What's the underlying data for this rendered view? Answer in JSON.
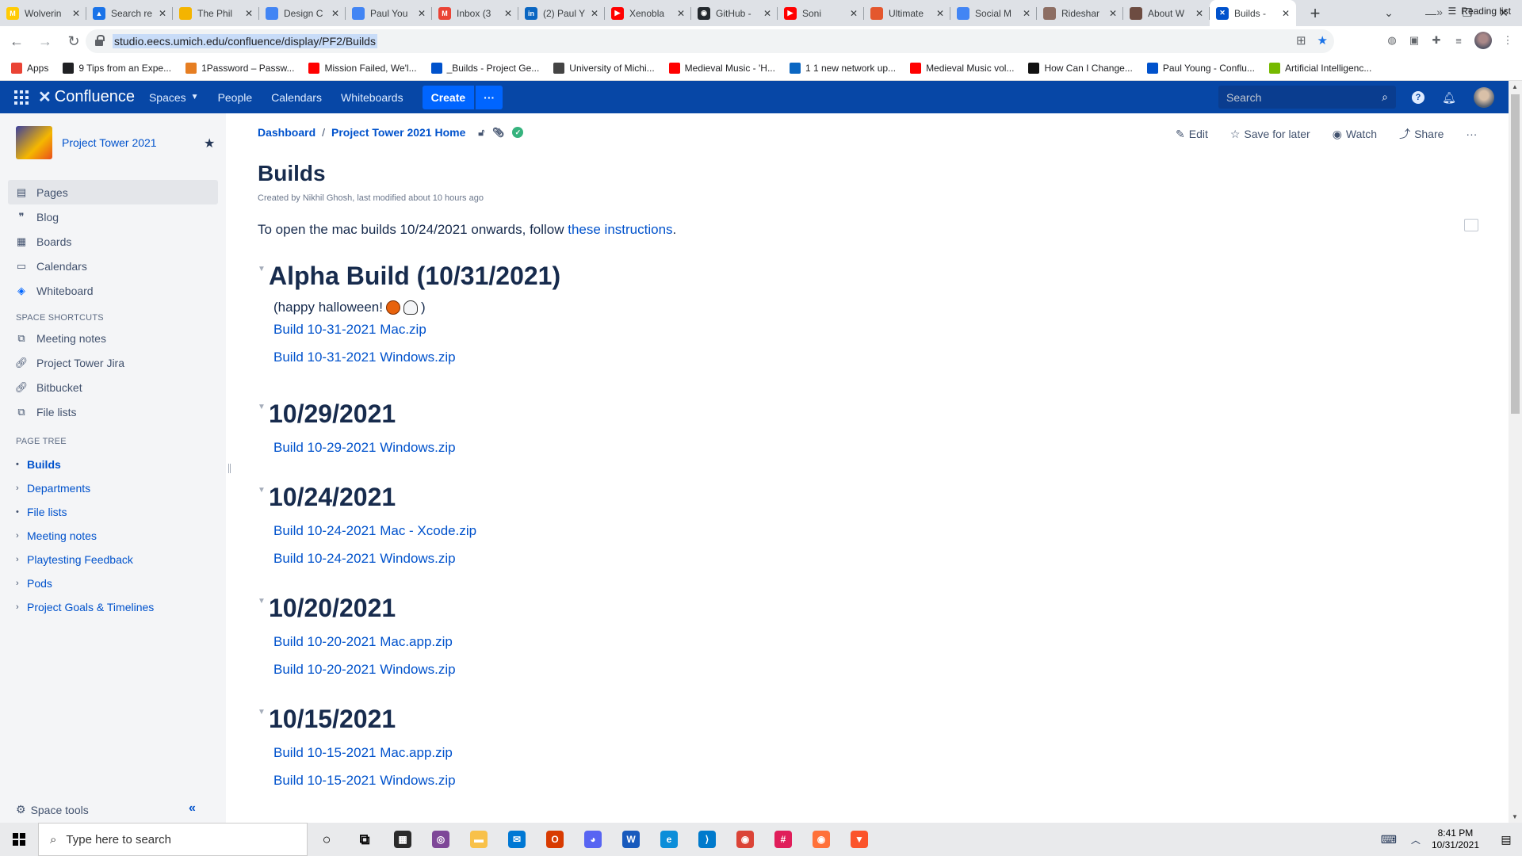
{
  "browser": {
    "tabs": [
      {
        "title": "Wolverin",
        "icon_color": "#ffcb05",
        "icon_text": "M",
        "icon": "gmail-wolverine-icon"
      },
      {
        "title": "Search re",
        "icon_color": "#1a73e8",
        "icon_text": "▲",
        "icon": "google-drive-icon"
      },
      {
        "title": "The Phil",
        "icon_color": "#f4b400",
        "icon_text": "",
        "icon": "google-slides-icon"
      },
      {
        "title": "Design C",
        "icon_color": "#4285f4",
        "icon_text": "",
        "icon": "google-docs-icon"
      },
      {
        "title": "Paul You",
        "icon_color": "#4285f4",
        "icon_text": "",
        "icon": "google-docs-icon"
      },
      {
        "title": "Inbox (3",
        "icon_color": "#ea4335",
        "icon_text": "M",
        "icon": "gmail-icon"
      },
      {
        "title": "(2) Paul Y",
        "icon_color": "#0a66c2",
        "icon_text": "in",
        "icon": "linkedin-icon"
      },
      {
        "title": "Xenobla",
        "icon_color": "#ff0000",
        "icon_text": "▶",
        "icon": "youtube-icon"
      },
      {
        "title": "GitHub -",
        "icon_color": "#24292e",
        "icon_text": "◉",
        "icon": "github-icon"
      },
      {
        "title": "Soni",
        "icon_color": "#ff0000",
        "icon_text": "▶",
        "icon": "youtube-icon"
      },
      {
        "title": "Ultimate",
        "icon_color": "#e4572e",
        "icon_text": "",
        "icon": "site-icon"
      },
      {
        "title": "Social M",
        "icon_color": "#4285f4",
        "icon_text": "",
        "icon": "site-icon"
      },
      {
        "title": "Rideshar",
        "icon_color": "#8d6e63",
        "icon_text": "",
        "icon": "image-icon"
      },
      {
        "title": "About W",
        "icon_color": "#6d4c41",
        "icon_text": "",
        "icon": "site-icon"
      },
      {
        "title": "Builds -",
        "icon_color": "#0052cc",
        "icon_text": "✕",
        "icon": "confluence-icon",
        "active": true
      }
    ],
    "url": "studio.eecs.umich.edu/confluence/display/PF2/Builds",
    "bookmarks": [
      {
        "label": "Apps",
        "icon_color": "#ea4335"
      },
      {
        "label": "9 Tips from an Expe...",
        "icon_color": "#202124"
      },
      {
        "label": "1Password – Passw...",
        "icon_color": "#e67e22"
      },
      {
        "label": "Mission Failed, We'l...",
        "icon_color": "#ff0000"
      },
      {
        "label": "_Builds - Project Ge...",
        "icon_color": "#0052cc"
      },
      {
        "label": "University of Michi...",
        "icon_color": "#444"
      },
      {
        "label": "Medieval Music - 'H...",
        "icon_color": "#ff0000"
      },
      {
        "label": "1 1 new network up...",
        "icon_color": "#0a66c2"
      },
      {
        "label": "Medieval Music vol...",
        "icon_color": "#ff0000"
      },
      {
        "label": "How Can I Change...",
        "icon_color": "#111"
      },
      {
        "label": "Paul Young - Conflu...",
        "icon_color": "#0052cc"
      },
      {
        "label": "Artificial Intelligenc...",
        "icon_color": "#76b900"
      }
    ],
    "reading_list": "Reading list"
  },
  "confluence_nav": {
    "product": "Confluence",
    "items": [
      "Spaces",
      "People",
      "Calendars",
      "Whiteboards"
    ],
    "create": "Create",
    "more": "···",
    "search_placeholder": "Search"
  },
  "sidebar": {
    "space_name": "Project Tower 2021",
    "items": [
      "Pages",
      "Blog",
      "Boards",
      "Calendars",
      "Whiteboard"
    ],
    "shortcuts_heading": "SPACE SHORTCUTS",
    "shortcuts": [
      "Meeting notes",
      "Project Tower Jira",
      "Bitbucket",
      "File lists"
    ],
    "tree_heading": "PAGE TREE",
    "tree": [
      "Builds",
      "Departments",
      "File lists",
      "Meeting notes",
      "Playtesting Feedback",
      "Pods",
      "Project Goals & Timelines"
    ],
    "space_tools": "Space tools"
  },
  "page": {
    "breadcrumb": [
      "Dashboard",
      "Project Tower 2021 Home"
    ],
    "actions": [
      "Edit",
      "Save for later",
      "Watch",
      "Share",
      "···"
    ],
    "title": "Builds",
    "byline": "Created by Nikhil Ghosh, last modified about 10 hours ago",
    "intro_text": "To open the mac builds 10/24/2021 onwards, follow ",
    "intro_link": "these instructions",
    "intro_end": ".",
    "sections": [
      {
        "heading": "Alpha Build (10/31/2021)",
        "note_open": "(happy halloween!",
        "note_close": ")",
        "links": [
          "Build 10-31-2021 Mac.zip",
          "Build 10-31-2021 Windows.zip"
        ]
      },
      {
        "heading": "10/29/2021",
        "links": [
          "Build 10-29-2021 Windows.zip"
        ]
      },
      {
        "heading": "10/24/2021",
        "links": [
          "Build 10-24-2021 Mac - Xcode.zip",
          "Build 10-24-2021 Windows.zip"
        ]
      },
      {
        "heading": "10/20/2021",
        "links": [
          "Build 10-20-2021 Mac.app.zip",
          "Build 10-20-2021 Windows.zip"
        ]
      },
      {
        "heading": "10/15/2021",
        "links": [
          "Build 10-15-2021 Mac.app.zip",
          "Build 10-15-2021 Windows.zip"
        ]
      }
    ]
  },
  "taskbar": {
    "search_placeholder": "Type here to search",
    "time": "8:41 PM",
    "date": "10/31/2021",
    "apps": [
      {
        "name": "cortana-icon",
        "color": "#000000",
        "text": "○"
      },
      {
        "name": "task-view-icon",
        "color": "#000000",
        "text": "⧉"
      },
      {
        "name": "store-icon",
        "color": "#2b2b2b",
        "text": "▦"
      },
      {
        "name": "tor-icon",
        "color": "#7e4798",
        "text": "◎"
      },
      {
        "name": "file-explorer-icon",
        "color": "#f8c14a",
        "text": "▬"
      },
      {
        "name": "mail-icon",
        "color": "#0078d4",
        "text": "✉"
      },
      {
        "name": "office-icon",
        "color": "#d83b01",
        "text": "O"
      },
      {
        "name": "discord-icon",
        "color": "#5865f2",
        "text": "◕"
      },
      {
        "name": "word-icon",
        "color": "#185abd",
        "text": "W"
      },
      {
        "name": "edge-icon",
        "color": "#0c8ed9",
        "text": "e"
      },
      {
        "name": "vscode-icon",
        "color": "#007acc",
        "text": "⟩"
      },
      {
        "name": "chrome-icon",
        "color": "#db4437",
        "text": "◉"
      },
      {
        "name": "slack-icon",
        "color": "#e01e5a",
        "text": "#"
      },
      {
        "name": "firefox-icon",
        "color": "#ff7139",
        "text": "◉"
      },
      {
        "name": "brave-icon",
        "color": "#fb542b",
        "text": "▼"
      }
    ]
  },
  "colors": {
    "confluence_nav": "#0747a6",
    "link": "#0052cc",
    "text": "#172b4d",
    "sidebar_bg": "#f4f5f7"
  }
}
